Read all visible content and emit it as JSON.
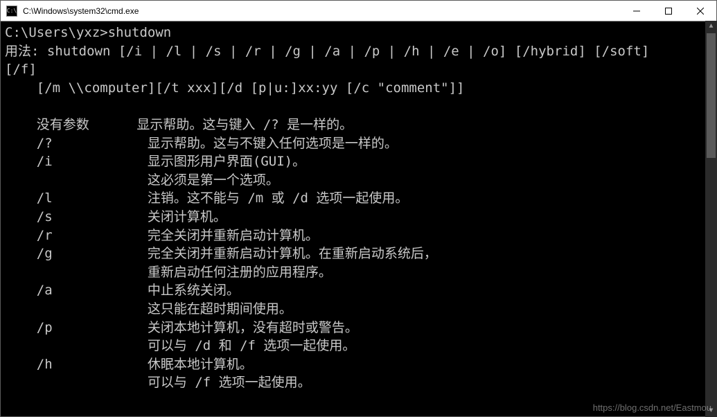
{
  "window": {
    "title": "C:\\Windows\\system32\\cmd.exe",
    "icon_label": "C:\\"
  },
  "terminal": {
    "prompt": "C:\\Users\\yxz>",
    "command": "shutdown",
    "usage_label": "用法:",
    "usage_line1": "shutdown [/i | /l | /s | /r | /g | /a | /p | /h | /e | /o] [/hybrid] [/soft]",
    "usage_line2": "[/f]",
    "usage_line3": "    [/m \\\\computer][/t xxx][/d [p|u:]xx:yy [/c \"comment\"]]",
    "options": [
      {
        "flag": "没有参数",
        "desc": [
          "显示帮助。这与键入 /? 是一样的。"
        ]
      },
      {
        "flag": "/?",
        "desc": [
          "显示帮助。这与不键入任何选项是一样的。"
        ]
      },
      {
        "flag": "/i",
        "desc": [
          "显示图形用户界面(GUI)。",
          "这必须是第一个选项。"
        ]
      },
      {
        "flag": "/l",
        "desc": [
          "注销。这不能与 /m 或 /d 选项一起使用。"
        ]
      },
      {
        "flag": "/s",
        "desc": [
          "关闭计算机。"
        ]
      },
      {
        "flag": "/r",
        "desc": [
          "完全关闭并重新启动计算机。"
        ]
      },
      {
        "flag": "/g",
        "desc": [
          "完全关闭并重新启动计算机。在重新启动系统后，",
          "重新启动任何注册的应用程序。"
        ]
      },
      {
        "flag": "/a",
        "desc": [
          "中止系统关闭。",
          "这只能在超时期间使用。"
        ]
      },
      {
        "flag": "/p",
        "desc": [
          "关闭本地计算机，没有超时或警告。",
          "可以与 /d 和 /f 选项一起使用。"
        ]
      },
      {
        "flag": "/h",
        "desc": [
          "休眠本地计算机。",
          "可以与 /f 选项一起使用。"
        ]
      }
    ]
  },
  "watermark": "https://blog.csdn.net/Eastmou"
}
